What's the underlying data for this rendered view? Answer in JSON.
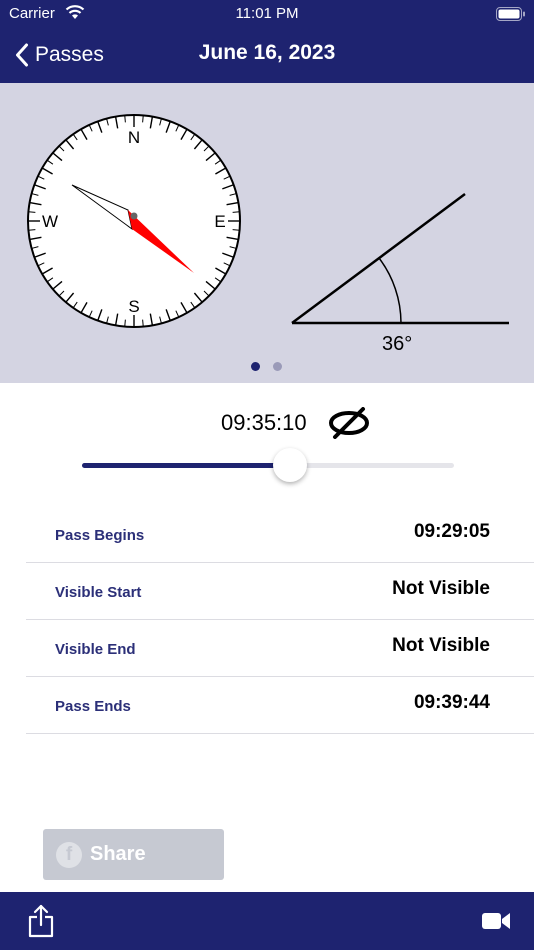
{
  "status_bar": {
    "carrier": "Carrier",
    "time": "11:01 PM"
  },
  "nav": {
    "back_label": "Passes",
    "title": "June 16, 2023"
  },
  "compass": {
    "north": "N",
    "east": "E",
    "south": "S",
    "west": "W"
  },
  "elevation": {
    "angle_label": "36°",
    "angle_degrees": 36
  },
  "page_indicator": {
    "pages": 2,
    "current": 1
  },
  "timeline": {
    "current_time": "09:35:10",
    "progress": 0.56
  },
  "pass_details": [
    {
      "label": "Pass Begins",
      "value": "09:29:05"
    },
    {
      "label": "Visible Start",
      "value": "Not Visible"
    },
    {
      "label": "Visible End",
      "value": "Not Visible"
    },
    {
      "label": "Pass Ends",
      "value": "09:39:44"
    }
  ],
  "share_button": {
    "label": "Share"
  },
  "colors": {
    "primary": "#1e2370",
    "panel": "#d4d4e2",
    "needle": "#ff0000",
    "share_bg": "#c6c9d2"
  },
  "icons": {
    "back": "chevron-left-icon",
    "wifi": "wifi-icon",
    "battery": "battery-icon",
    "not_visible": "eye-slash-icon",
    "facebook": "facebook-icon",
    "share": "share-icon",
    "video": "video-camera-icon"
  }
}
